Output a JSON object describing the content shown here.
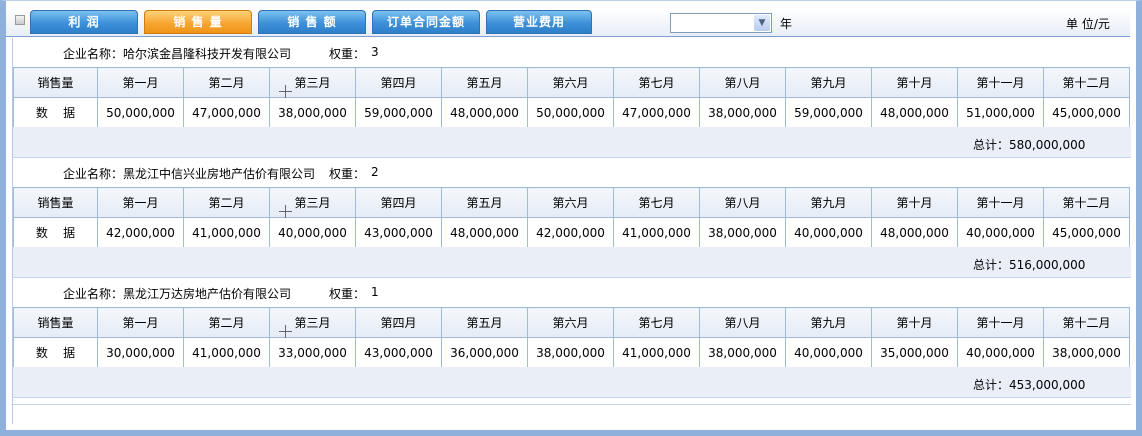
{
  "tabs": [
    {
      "label": "利  润",
      "active": false
    },
    {
      "label": "销 售 量",
      "active": true
    },
    {
      "label": "销 售 额",
      "active": false
    },
    {
      "label": "订单合同金额",
      "active": false
    },
    {
      "label": "营业费用",
      "active": false
    }
  ],
  "year_select_value": "",
  "year_label": "年",
  "unit_label": "单 位/元",
  "name_label": "企业名称：",
  "weight_label": "权重：",
  "total_label": "总计：",
  "header": [
    "销售量",
    "第一月",
    "第二月",
    "第三月",
    "第四月",
    "第五月",
    "第六月",
    "第七月",
    "第八月",
    "第九月",
    "第十月",
    "第十一月",
    "第十二月"
  ],
  "row_label": "数    据",
  "companies": [
    {
      "name": "哈尔滨金昌隆科技开发有限公司",
      "weight": "3",
      "values": [
        "50,000,000",
        "47,000,000",
        "38,000,000",
        "59,000,000",
        "48,000,000",
        "50,000,000",
        "47,000,000",
        "38,000,000",
        "59,000,000",
        "48,000,000",
        "51,000,000",
        "45,000,000"
      ],
      "total": "580,000,000"
    },
    {
      "name": "黑龙江中信兴业房地产估价有限公司",
      "weight": "2",
      "values": [
        "42,000,000",
        "41,000,000",
        "40,000,000",
        "43,000,000",
        "48,000,000",
        "42,000,000",
        "41,000,000",
        "38,000,000",
        "40,000,000",
        "48,000,000",
        "40,000,000",
        "45,000,000"
      ],
      "total": "516,000,000"
    },
    {
      "name": "黑龙江万达房地产估价有限公司",
      "weight": "1",
      "values": [
        "30,000,000",
        "41,000,000",
        "33,000,000",
        "43,000,000",
        "36,000,000",
        "38,000,000",
        "41,000,000",
        "38,000,000",
        "40,000,000",
        "35,000,000",
        "40,000,000",
        "38,000,000"
      ],
      "total": "453,000,000"
    }
  ]
}
